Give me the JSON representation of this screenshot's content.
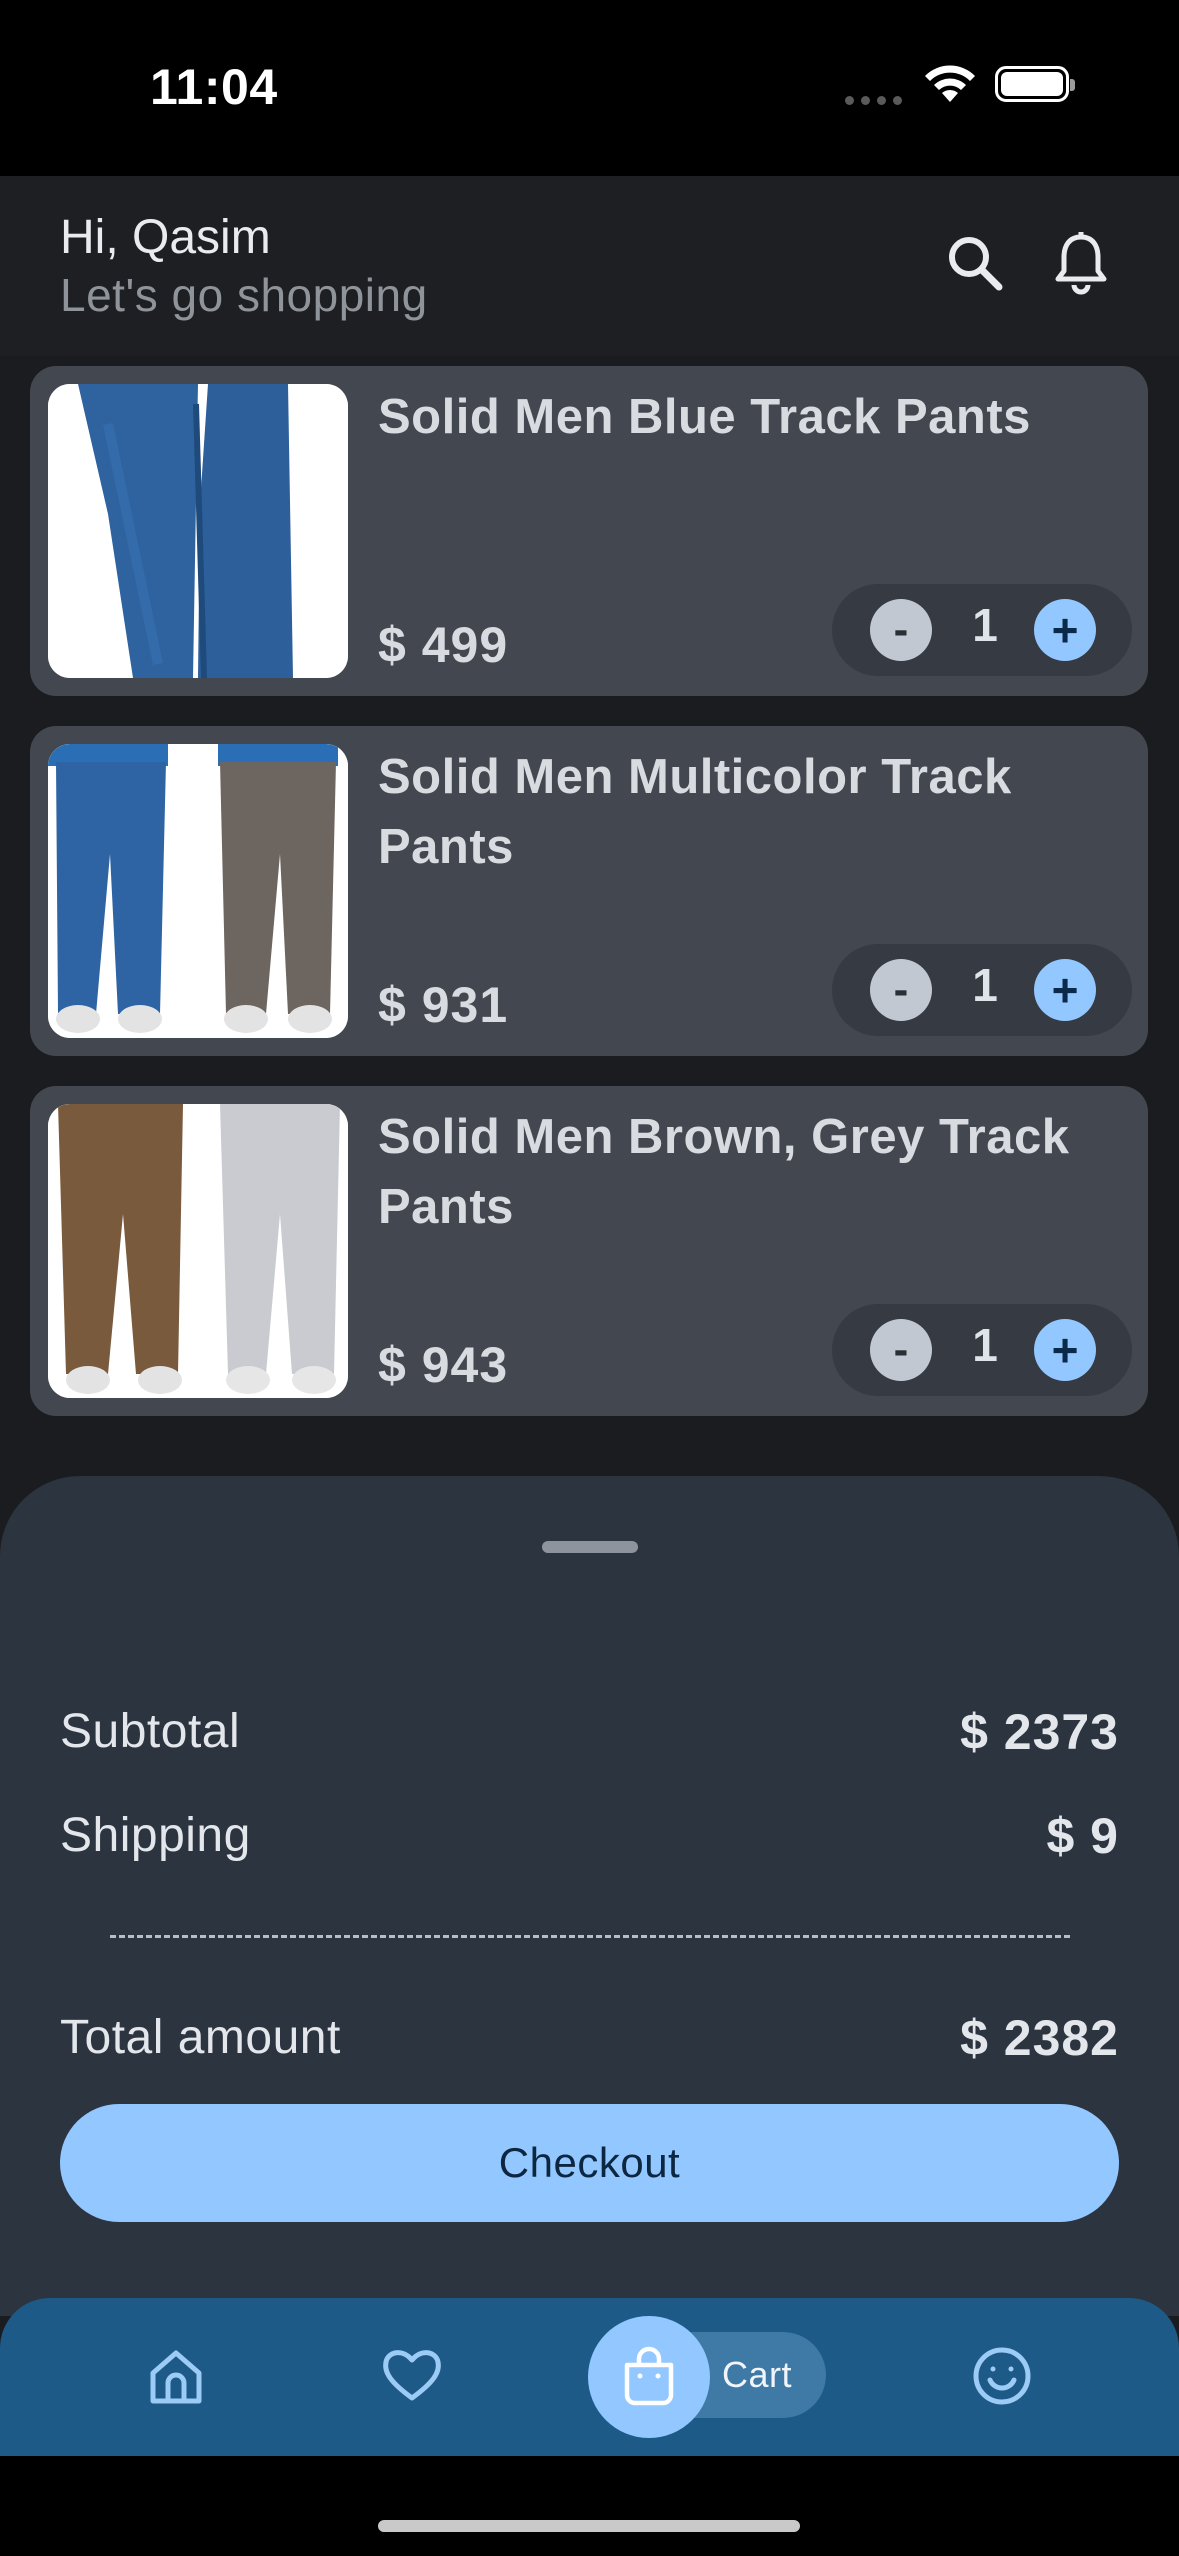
{
  "status": {
    "time": "11:04"
  },
  "header": {
    "greeting": "Hi, Qasim",
    "subtitle": "Let's go shopping"
  },
  "cart_items": [
    {
      "title": "Solid Men Blue Track Pants",
      "price": "$ 499",
      "qty": "1",
      "minus": "-",
      "plus": "+"
    },
    {
      "title": "Solid Men Multicolor Track Pants",
      "price": "$ 931",
      "qty": "1",
      "minus": "-",
      "plus": "+"
    },
    {
      "title": "Solid Men Brown, Grey Track Pants",
      "price": "$ 943",
      "qty": "1",
      "minus": "-",
      "plus": "+"
    }
  ],
  "summary": {
    "subtotal_label": "Subtotal",
    "subtotal_value": "$ 2373",
    "shipping_label": "Shipping",
    "shipping_value": "$ 9",
    "total_label": "Total amount",
    "total_value": "$ 2382",
    "checkout_label": "Checkout"
  },
  "nav": {
    "items": [
      {
        "icon": "home-icon"
      },
      {
        "icon": "heart-icon"
      },
      {
        "icon": "shopping-bag-icon",
        "label": "Cart",
        "active": true
      },
      {
        "icon": "smiley-icon"
      }
    ]
  },
  "colors": {
    "accent": "#92c7ff",
    "nav_bg": "#1d5a87",
    "card_bg": "#43474f",
    "sheet_bg": "#2c3440"
  }
}
